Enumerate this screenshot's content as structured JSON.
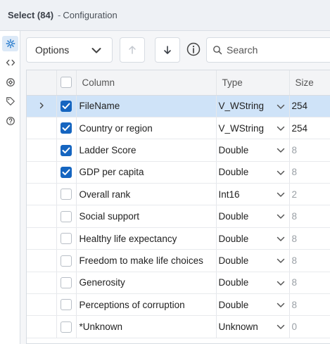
{
  "header": {
    "title": "Select (84)",
    "separator": "-",
    "subtitle": "Configuration"
  },
  "rail": {
    "icons": [
      "gear-icon",
      "code-icon",
      "settings-circle-icon",
      "tag-icon",
      "help-icon"
    ]
  },
  "toolbar": {
    "options_label": "Options",
    "search_placeholder": "Search"
  },
  "grid": {
    "columns": {
      "column": "Column",
      "type": "Type",
      "size": "Size"
    },
    "rows": [
      {
        "name": "FileName",
        "type": "V_WString",
        "size": "254",
        "checked": true,
        "selected": true
      },
      {
        "name": "Country or region",
        "type": "V_WString",
        "size": "254",
        "checked": true,
        "selected": false
      },
      {
        "name": "Ladder Score",
        "type": "Double",
        "size": "8",
        "checked": true,
        "selected": false
      },
      {
        "name": "GDP per capita",
        "type": "Double",
        "size": "8",
        "checked": true,
        "selected": false
      },
      {
        "name": "Overall rank",
        "type": "Int16",
        "size": "2",
        "checked": false,
        "selected": false
      },
      {
        "name": "Social support",
        "type": "Double",
        "size": "8",
        "checked": false,
        "selected": false
      },
      {
        "name": "Healthy life expectancy",
        "type": "Double",
        "size": "8",
        "checked": false,
        "selected": false
      },
      {
        "name": "Freedom to make life choices",
        "type": "Double",
        "size": "8",
        "checked": false,
        "selected": false
      },
      {
        "name": "Generosity",
        "type": "Double",
        "size": "8",
        "checked": false,
        "selected": false
      },
      {
        "name": "Perceptions of corruption",
        "type": "Double",
        "size": "8",
        "checked": false,
        "selected": false
      },
      {
        "name": "*Unknown",
        "type": "Unknown",
        "size": "0",
        "checked": false,
        "selected": false
      }
    ]
  },
  "colors": {
    "accent": "#1565c0",
    "selected_row": "#cfe3f8",
    "rail_active": "#dce9f7"
  }
}
